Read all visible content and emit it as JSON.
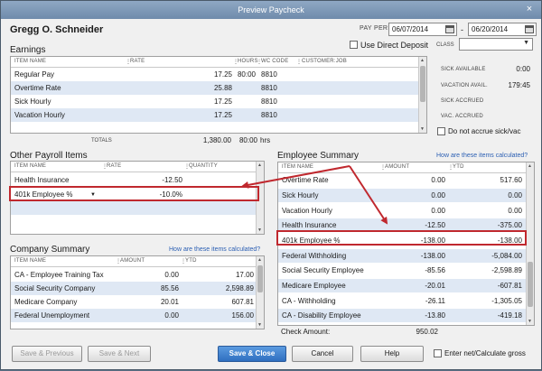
{
  "window": {
    "title": "Preview Paycheck",
    "close": "×"
  },
  "employee": {
    "name": "Gregg O. Schneider"
  },
  "pay_period": {
    "label": "PAY PERIOD",
    "from": "06/07/2014",
    "to": "06/20/2014",
    "separator": "-"
  },
  "direct_deposit": {
    "label": "Use Direct Deposit"
  },
  "class_field": {
    "label": "CLASS",
    "value": ""
  },
  "earnings": {
    "title": "Earnings",
    "headers": {
      "item_name": "ITEM NAME",
      "rate": "RATE",
      "hours": "HOURS",
      "wc_code": "WC CODE",
      "customer_job": "CUSTOMER:JOB"
    },
    "rows": [
      {
        "item": "Regular Pay",
        "rate": "17.25",
        "hours": "80:00",
        "wc": "8810"
      },
      {
        "item": "Overtime Rate",
        "rate": "25.88",
        "hours": "",
        "wc": "8810"
      },
      {
        "item": "Sick Hourly",
        "rate": "17.25",
        "hours": "",
        "wc": "8810"
      },
      {
        "item": "Vacation Hourly",
        "rate": "17.25",
        "hours": "",
        "wc": "8810"
      }
    ],
    "totals_label": "TOTALS",
    "total_amount": "1,380.00",
    "total_hours": "80:00",
    "hours_unit": "hrs"
  },
  "accruals": {
    "sick_available_label": "SICK AVAILABLE",
    "sick_available": "0:00",
    "vacation_avail_label": "VACATION AVAIL.",
    "vacation_avail": "179:45",
    "sick_accrued_label": "SICK ACCRUED",
    "sick_accrued": "",
    "vac_accrued_label": "VAC. ACCRUED",
    "vac_accrued": "",
    "do_not_accrue_label": "Do not accrue sick/vac"
  },
  "other_payroll": {
    "title": "Other Payroll Items",
    "headers": {
      "item_name": "ITEM NAME",
      "rate": "RATE",
      "quantity": "QUANTITY"
    },
    "rows": [
      {
        "item": "Health Insurance",
        "rate": "-12.50",
        "quantity": ""
      },
      {
        "item": "401k Employee %",
        "rate": "-10.0%",
        "quantity": ""
      }
    ]
  },
  "employee_summary": {
    "title": "Employee Summary",
    "link": "How are these items calculated?",
    "headers": {
      "item_name": "ITEM NAME",
      "amount": "AMOUNT",
      "ytd": "YTD"
    },
    "rows": [
      {
        "item": "Overtime Rate",
        "amount": "0.00",
        "ytd": "517.60"
      },
      {
        "item": "Sick Hourly",
        "amount": "0.00",
        "ytd": "0.00"
      },
      {
        "item": "Vacation Hourly",
        "amount": "0.00",
        "ytd": "0.00"
      },
      {
        "item": "Health Insurance",
        "amount": "-12.50",
        "ytd": "-375.00"
      },
      {
        "item": "401k Employee %",
        "amount": "-138.00",
        "ytd": "-138.00"
      },
      {
        "item": "Federal Withholding",
        "amount": "-138.00",
        "ytd": "-5,084.00"
      },
      {
        "item": "Social Security Employee",
        "amount": "-85.56",
        "ytd": "-2,598.89"
      },
      {
        "item": "Medicare Employee",
        "amount": "-20.01",
        "ytd": "-607.81"
      },
      {
        "item": "CA - Withholding",
        "amount": "-26.11",
        "ytd": "-1,305.05"
      },
      {
        "item": "CA - Disability Employee",
        "amount": "-13.80",
        "ytd": "-419.18"
      }
    ],
    "check_amount_label": "Check Amount:",
    "check_amount": "950.02"
  },
  "company_summary": {
    "title": "Company Summary",
    "link": "How are these items calculated?",
    "headers": {
      "item_name": "ITEM NAME",
      "amount": "AMOUNT",
      "ytd": "YTD"
    },
    "rows": [
      {
        "item": "CA - Employee Training Tax",
        "amount": "0.00",
        "ytd": "17.00"
      },
      {
        "item": "Social Security Company",
        "amount": "85.56",
        "ytd": "2,598.89"
      },
      {
        "item": "Medicare Company",
        "amount": "20.01",
        "ytd": "607.81"
      },
      {
        "item": "Federal Unemployment",
        "amount": "0.00",
        "ytd": "156.00"
      }
    ]
  },
  "buttons": {
    "save_previous": "Save & Previous",
    "save_next": "Save & Next",
    "save_close": "Save & Close",
    "cancel": "Cancel",
    "help": "Help",
    "enter_net_label": "Enter net/Calculate gross"
  },
  "colors": {
    "highlight": "#c0282e",
    "link": "#2b5fb3",
    "alt_row": "#dfe8f4",
    "primary_button": "#2f6fc0"
  }
}
